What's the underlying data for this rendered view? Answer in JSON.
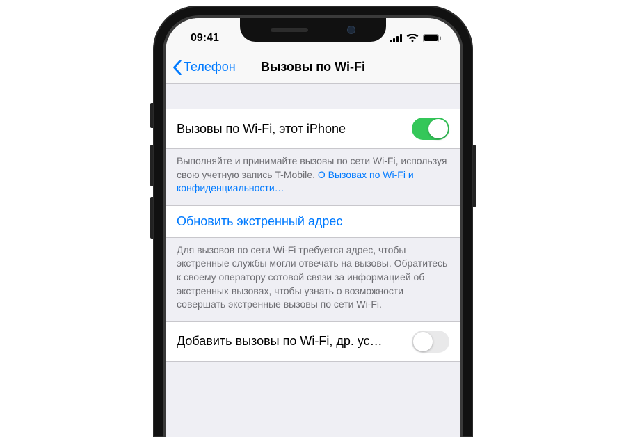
{
  "status": {
    "time": "09:41"
  },
  "nav": {
    "back_label": "Телефон",
    "title": "Вызовы по Wi-Fi"
  },
  "row1": {
    "label": "Вызовы по Wi-Fi, этот iPhone",
    "toggle_on": true
  },
  "footer1": {
    "text": "Выполняйте и принимайте вызовы по сети Wi-Fi, используя свою учетную запись T-Mobile. ",
    "link": "О Вызовах по Wi-Fi и конфиденциальности…"
  },
  "row2": {
    "label": "Обновить экстренный адрес"
  },
  "footer2": {
    "text": "Для вызовов по сети Wi-Fi требуется адрес, чтобы экстренные службы могли отвечать на вызовы. Обратитесь к своему оператору сотовой связи за информацией об экстренных вызовах, чтобы узнать о возможности совершать экстренные вызовы по сети Wi-Fi."
  },
  "row3": {
    "label": "Добавить вызовы по Wi-Fi, др. ус…",
    "toggle_on": false
  }
}
